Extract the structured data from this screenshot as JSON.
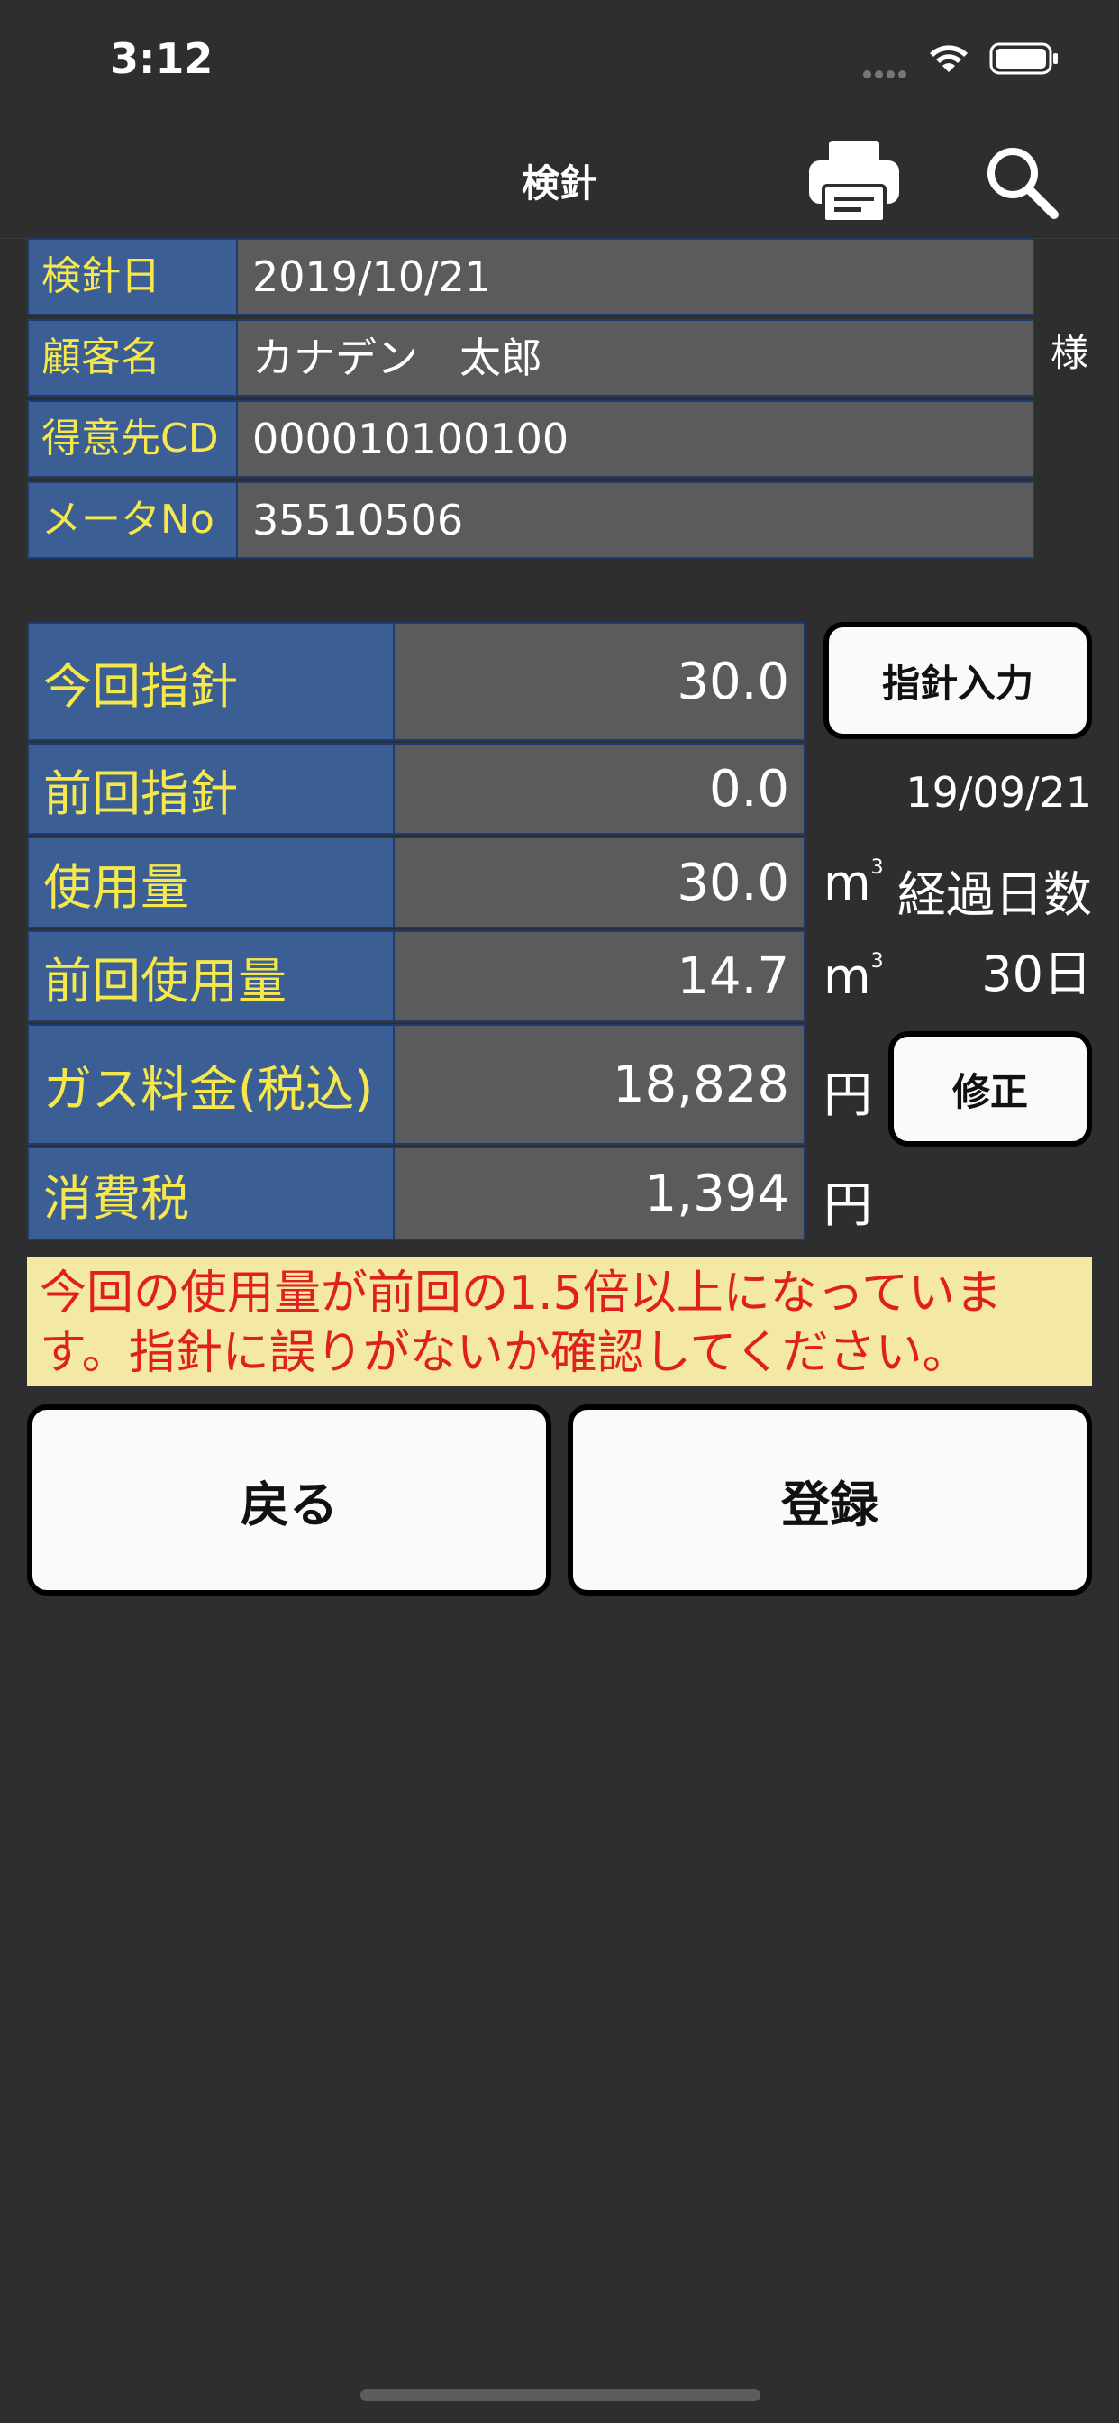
{
  "status_bar": {
    "time": "3:12"
  },
  "nav": {
    "title": "検針"
  },
  "info": {
    "rows": [
      {
        "label": "検針日",
        "value": "2019/10/21"
      },
      {
        "label": "顧客名",
        "value": "カナデン　太郎"
      },
      {
        "label": "得意先CD",
        "value": "000010100100"
      },
      {
        "label": "メータNo",
        "value": "35510506"
      }
    ],
    "honorific": "様"
  },
  "readings": {
    "current_reading": {
      "label": "今回指針",
      "value": "30.0"
    },
    "previous_reading": {
      "label": "前回指針",
      "value": "0.0"
    },
    "usage": {
      "label": "使用量",
      "value": "30.0",
      "unit": "m"
    },
    "previous_usage": {
      "label": "前回使用量",
      "value": "14.7",
      "unit": "m"
    },
    "gas_fee": {
      "label": "ガス料金(税込)",
      "value": "18,828",
      "unit": "円"
    },
    "tax": {
      "label": "消費税",
      "value": "1,394",
      "unit": "円"
    },
    "unit_superscript": "3"
  },
  "side": {
    "input_button": "指針入力",
    "previous_date": "19/09/21",
    "elapsed_label": "経過日数",
    "elapsed_value": "30日",
    "correct_button": "修正"
  },
  "warning": "今回の使用量が前回の1.5倍以上になっています。指針に誤りがないか確認してください。",
  "actions": {
    "back": "戻る",
    "register": "登録"
  },
  "colors": {
    "background": "#2e2e2e",
    "label_bg": "#3b5f94",
    "label_text": "#f6e84a",
    "value_bg": "#5b5b5b",
    "warning_bg": "#f3e9a5",
    "warning_text": "#e0201f"
  }
}
